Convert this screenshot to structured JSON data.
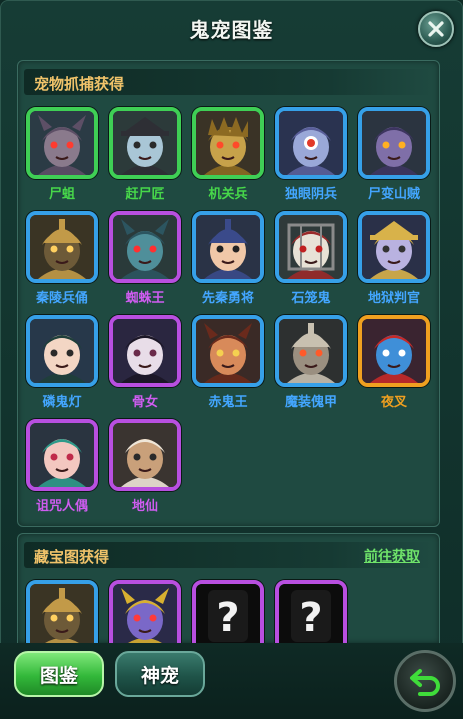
{
  "window": {
    "title": "鬼宠图鉴"
  },
  "section_capture": {
    "title": "宠物抓捕获得",
    "pets": [
      {
        "name": "尸蛆",
        "rarity": "green",
        "art": "dragon"
      },
      {
        "name": "赶尸匠",
        "rarity": "green",
        "art": "hatgirl"
      },
      {
        "name": "机关兵",
        "rarity": "green",
        "art": "robot"
      },
      {
        "name": "独眼阴兵",
        "rarity": "blue",
        "art": "cyclops"
      },
      {
        "name": "尸变山贼",
        "rarity": "blue",
        "art": "zombie"
      },
      {
        "name": "秦陵兵俑",
        "rarity": "blue",
        "art": "warrior"
      },
      {
        "name": "蜘蛛王",
        "rarity": "purple",
        "art": "spider"
      },
      {
        "name": "先秦勇将",
        "rarity": "blue",
        "art": "general"
      },
      {
        "name": "石笼鬼",
        "rarity": "blue",
        "art": "cage"
      },
      {
        "name": "地狱判官",
        "rarity": "blue",
        "art": "judge"
      },
      {
        "name": "磷鬼灯",
        "rarity": "blue",
        "art": "lanterngirl"
      },
      {
        "name": "骨女",
        "rarity": "purple",
        "art": "bonegirl"
      },
      {
        "name": "赤鬼王",
        "rarity": "blue",
        "art": "redking"
      },
      {
        "name": "魔装傀甲",
        "rarity": "blue",
        "art": "armor"
      },
      {
        "name": "夜叉",
        "rarity": "orange",
        "art": "yaksha"
      },
      {
        "name": "诅咒人偶",
        "rarity": "purple",
        "art": "doll"
      },
      {
        "name": "地仙",
        "rarity": "purple",
        "art": "monkey"
      }
    ]
  },
  "section_treasure": {
    "title": "藏宝图获得",
    "link_label": "前往获取",
    "pets": [
      {
        "rarity": "blue",
        "art": "warrior"
      },
      {
        "rarity": "purple",
        "art": "mask"
      },
      {
        "rarity": "purple",
        "art": "unknown",
        "glyph": "?"
      },
      {
        "rarity": "purple",
        "art": "unknown",
        "glyph": "?"
      }
    ]
  },
  "tabs": [
    {
      "label": "图鉴",
      "active": true
    },
    {
      "label": "神宠",
      "active": false
    }
  ],
  "icons": {
    "close": "close-icon",
    "back": "back-arrow-icon"
  },
  "colors": {
    "green": "#3fcf55",
    "blue": "#36a0e8",
    "purple": "#b84fe0",
    "orange": "#f0a020",
    "section_title": "#f0c36a",
    "link": "#6fe36a"
  }
}
